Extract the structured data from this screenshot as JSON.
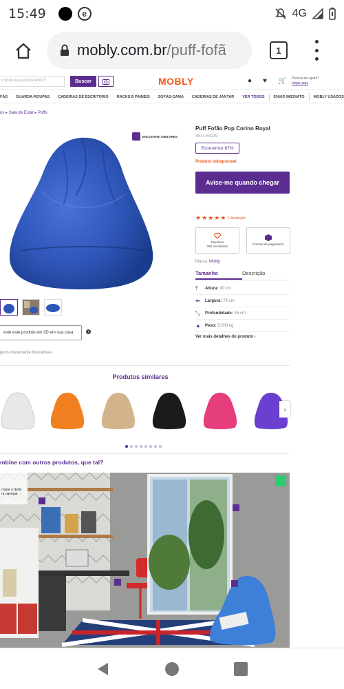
{
  "status_bar": {
    "time": "15:49",
    "app_badge": "e",
    "network": "4G"
  },
  "browser": {
    "url_host": "mobly.com.br",
    "url_path": "/puff-fofã",
    "tab_count": "1"
  },
  "site_header": {
    "search_placeholder": "o você está procurando?",
    "search_button": "Buscar",
    "logo": "MOBLY",
    "help_line1": "Precisa de ajuda?",
    "help_line2": "clique aqui",
    "nav": [
      "FÁS",
      "GUARDA-ROUPAS",
      "CADEIRAS DE ESCRITÓRIO",
      "RACKS E PAINÉIS",
      "SOFÁS-CAMA",
      "CADEIRAS DE JANTAR",
      "VER TODOS",
      "ENVIO IMEDIATO",
      "MOBLY USADOS"
    ]
  },
  "breadcrumb": {
    "items": [
      "os",
      "Sala de Estar",
      "Puffs"
    ]
  },
  "product": {
    "similar_badge": "ENCONTRE SIMILARES",
    "title": "Puff Fofão Pop Corino Royal",
    "sku": "SKU: 64139",
    "discount": "Economize 67%",
    "availability": "Produto indisponível",
    "notify_button": "Avise-me quando chegar",
    "rating": 5,
    "rating_text": "1 Avaliação",
    "favorites_label": "Favoritos",
    "favorites_count": "459 favoritaram",
    "payment_label": "Formas de pagamento",
    "brand_label": "Marca:",
    "brand_value": "Mobly",
    "tabs": [
      "Tamanho",
      "Descrição"
    ],
    "specs": [
      {
        "key": "Altura:",
        "value": "90 cm"
      },
      {
        "key": "Largura:",
        "value": "76 cm"
      },
      {
        "key": "Profundidade:",
        "value": "45 cm"
      },
      {
        "key": "Peso:",
        "value": "5,000 kg"
      }
    ],
    "more_details": "Ver mais detalhes do produto ›",
    "ar_button": "este este produto em 3D em sua casa",
    "image_note": "gens meramente ilustrativas"
  },
  "similar": {
    "title": "Produtos similares",
    "colors": [
      "#e8e8e8",
      "#f07f1f",
      "#d2b48c",
      "#1a1a1a",
      "#e63d7c",
      "#6b3fd0"
    ],
    "dot_count": 8,
    "active_dot": 0
  },
  "combine": {
    "title": "mbine com outros produtos, que tal?",
    "hint": "rraste o dedo ra navegar"
  },
  "colors": {
    "brand_purple": "#5b2d90",
    "brand_orange": "#f05a1e",
    "product_blue": "#2e55b8"
  }
}
